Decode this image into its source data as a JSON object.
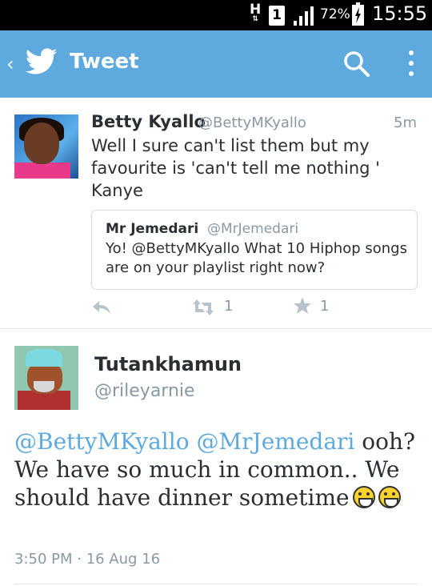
{
  "status_bar": {
    "network": "H",
    "sim": "1",
    "battery_pct": "72%",
    "time": "15:55"
  },
  "toolbar": {
    "back": "‹",
    "title": "Tweet",
    "color": "#5ea9dd"
  },
  "tweet": {
    "author_name": "Betty Kyallo",
    "author_handle": "@BettyMKyallo",
    "age": "5m",
    "text": "Well I sure can't list them but my\nfavourite is 'can't tell me nothing '\nKanye",
    "quote": {
      "author_name": "Mr Jemedari",
      "author_handle": "@MrJemedari",
      "text": "Yo! @BettyMKyallo What 10 Hiphop songs are on your playlist right now?"
    },
    "actions": {
      "retweets": "1",
      "favorites": "1"
    }
  },
  "reply": {
    "author_name": "Tutankhamun",
    "author_handle": "@rileyarnie",
    "mention1": "@BettyMKyallo",
    "mention2": "@MrJemedari",
    "text": "ooh? We have so much in common.. We should have dinner sometime",
    "timestamp": "3:50 PM · 16 Aug 16"
  },
  "icons": [
    "back-chevron-icon",
    "twitter-bird-icon",
    "search-icon",
    "overflow-menu-icon",
    "reply-icon",
    "retweet-icon",
    "favorite-star-icon",
    "grinning-emoji-icon"
  ]
}
